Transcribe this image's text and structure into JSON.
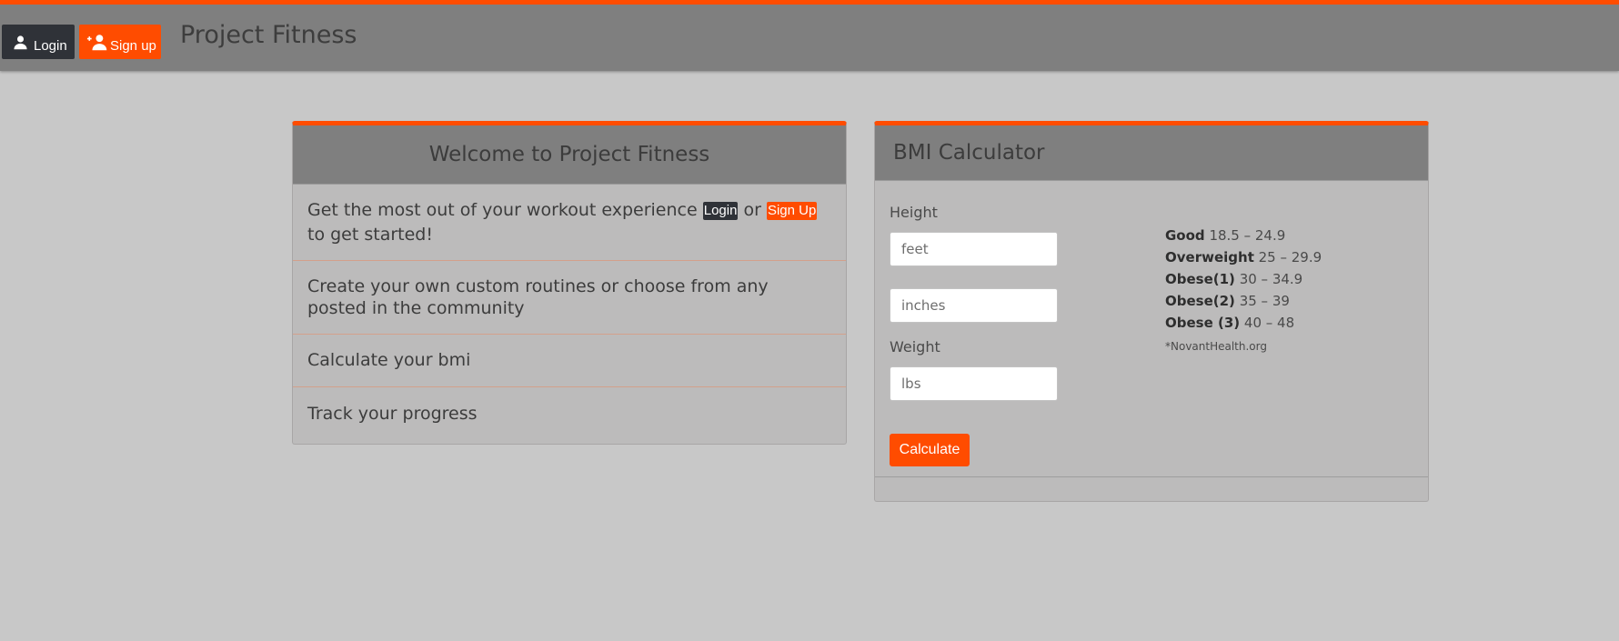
{
  "navbar": {
    "login_label": "Login",
    "signup_label": "Sign up",
    "brand": "Project Fitness",
    "login_icon": "person-icon",
    "signup_icon": "add-person-icon"
  },
  "welcome": {
    "title": "Welcome to Project Fitness",
    "items": [
      {
        "text_before": "Get the most out of your workout experience",
        "login_label": "Login",
        "connector": "or",
        "signup_label": "Sign Up",
        "text_after": "to get started!"
      },
      {
        "text": "Create your own custom routines or choose from any posted in the community"
      },
      {
        "text": "Calculate your bmi"
      },
      {
        "text": "Track your progress"
      }
    ]
  },
  "bmi": {
    "title": "BMI Calculator",
    "height_label": "Height",
    "feet_placeholder": "feet",
    "inches_placeholder": "inches",
    "weight_label": "Weight",
    "lbs_placeholder": "lbs",
    "calculate_label": "Calculate",
    "ranges": [
      {
        "category": "Good",
        "range": "18.5 – 24.9"
      },
      {
        "category": "Overweight",
        "range": "25 – 29.9"
      },
      {
        "category": "Obese(1)",
        "range": "30 – 34.9"
      },
      {
        "category": "Obese(2)",
        "range": "35 – 39"
      },
      {
        "category": "Obese (3)",
        "range": "40 – 48"
      }
    ],
    "source": "*NovantHealth.org"
  },
  "colors": {
    "accent": "#ff4c00",
    "navbar": "#7f7f7f",
    "background": "#c8c8c8",
    "card": "#bcbbbb",
    "dark_button": "#2f3238"
  }
}
